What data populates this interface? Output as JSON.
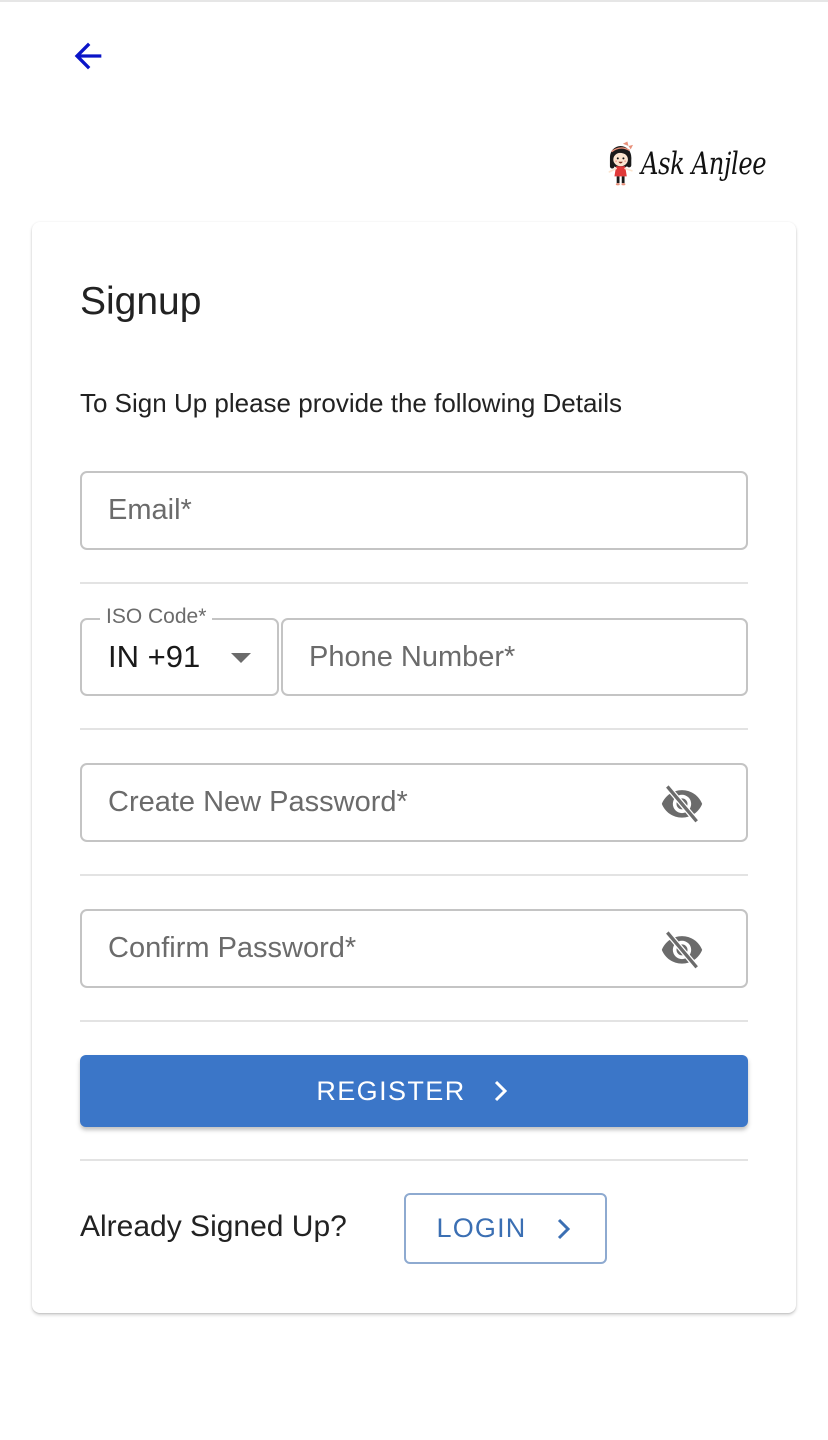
{
  "header": {
    "back_icon": "arrow-left-icon",
    "back_color": "#0a14c8",
    "logo": {
      "text": "Ask Anjlee",
      "mascot_icon": "girl-mascot-icon"
    }
  },
  "card": {
    "title": "Signup",
    "subtitle": "To Sign Up please provide the following Details",
    "email": {
      "placeholder": "Email*",
      "value": ""
    },
    "iso_code": {
      "label": "ISO Code*",
      "selected": "IN +91",
      "icon": "caret-down-icon"
    },
    "phone": {
      "placeholder": "Phone Number*",
      "value": ""
    },
    "new_password": {
      "placeholder": "Create New Password*",
      "value": "",
      "icon": "eye-off-icon"
    },
    "confirm_password": {
      "placeholder": "Confirm Password*",
      "value": "",
      "icon": "eye-off-icon"
    },
    "register_button": {
      "label": "REGISTER",
      "icon": "chevron-right-icon",
      "color": "#3b76c8"
    },
    "already_signed_up": "Already Signed Up?",
    "login_button": {
      "label": "LOGIN",
      "icon": "chevron-right-icon",
      "color": "#3b6fb3"
    }
  }
}
